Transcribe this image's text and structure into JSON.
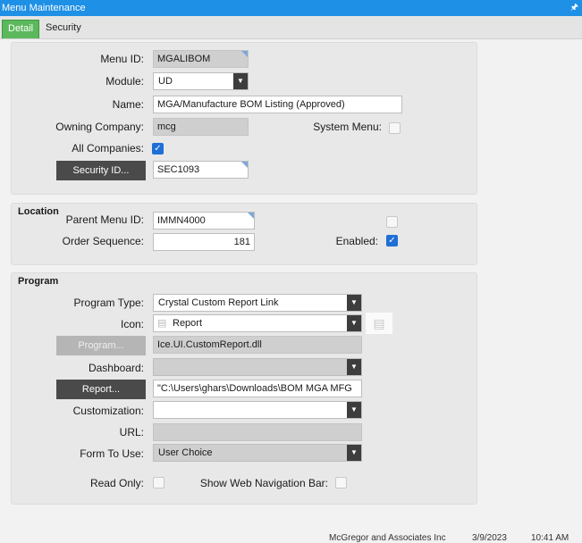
{
  "window": {
    "title": "Menu Maintenance"
  },
  "tabs": [
    {
      "label": "Detail"
    },
    {
      "label": "Security"
    }
  ],
  "detail": {
    "menu_id_label": "Menu ID:",
    "menu_id": "MGALIBOM",
    "module_label": "Module:",
    "module": "UD",
    "name_label": "Name:",
    "name": "MGA/Manufacture BOM Listing (Approved)",
    "owning_company_label": "Owning Company:",
    "owning_company": "mcg",
    "system_menu_label": "System Menu:",
    "all_companies_label": "All Companies:",
    "security_id_button": "Security ID...",
    "security_id": "SEC1093"
  },
  "location": {
    "title": "Location",
    "parent_menu_id_label": "Parent Menu ID:",
    "parent_menu_id": "IMMN4000",
    "order_sequence_label": "Order Sequence:",
    "order_sequence": "181",
    "enabled_label": "Enabled:"
  },
  "program": {
    "title": "Program",
    "program_type_label": "Program Type:",
    "program_type": "Crystal Custom Report Link",
    "icon_label": "Icon:",
    "icon": "Report",
    "program_button": "Program...",
    "program_value": "Ice.UI.CustomReport.dll",
    "dashboard_label": "Dashboard:",
    "dashboard": "",
    "report_button": "Report...",
    "report_value": "\"C:\\Users\\ghars\\Downloads\\BOM MGA MFG",
    "customization_label": "Customization:",
    "customization": "",
    "url_label": "URL:",
    "url": "",
    "form_to_use_label": "Form To Use:",
    "form_to_use": "User Choice",
    "read_only_label": "Read Only:",
    "show_web_nav_label": "Show Web Navigation Bar:"
  },
  "status": {
    "company": "McGregor and Associates Inc",
    "date": "3/9/2023",
    "time": "10:41 AM"
  },
  "colors": {
    "title_bar": "#1e90e6",
    "active_tab": "#5cb85c",
    "checkbox_on": "#1e6fd6"
  }
}
